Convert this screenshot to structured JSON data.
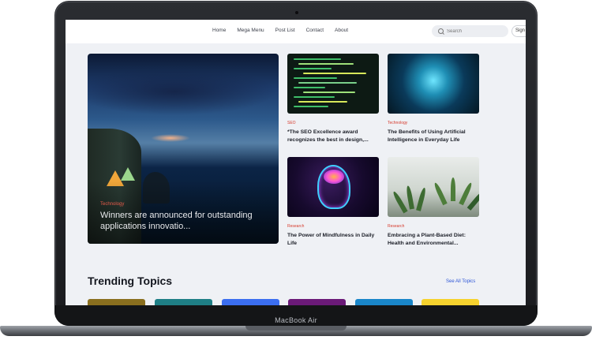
{
  "device": {
    "model_label": "MacBook Air"
  },
  "header": {
    "nav": [
      "Home",
      "Mega Menu",
      "Post List",
      "Contact",
      "About"
    ],
    "search_placeholder": "Search",
    "signin_label": "Sign"
  },
  "hero": {
    "category": "Technology",
    "title": "Winners are announced for outstanding applications innovatio..."
  },
  "cards": [
    {
      "category": "SEO",
      "title": "*The SEO Excellence award recognizes the best in design,..."
    },
    {
      "category": "Technology",
      "title": "The Benefits of Using Artificial Intelligence in Everyday Life"
    },
    {
      "category": "Research",
      "title": "The Power of Mindfulness in Daily Life"
    },
    {
      "category": "Research",
      "title": "Embracing a Plant-Based Diet: Health and Environmental..."
    }
  ],
  "trending": {
    "heading": "Trending Topics",
    "see_all": "See All Topics",
    "tile_colors": [
      "#8a6f1f",
      "#1f7f86",
      "#3b6ef0",
      "#6b1a78",
      "#1a86c9",
      "#f6d22e"
    ]
  }
}
